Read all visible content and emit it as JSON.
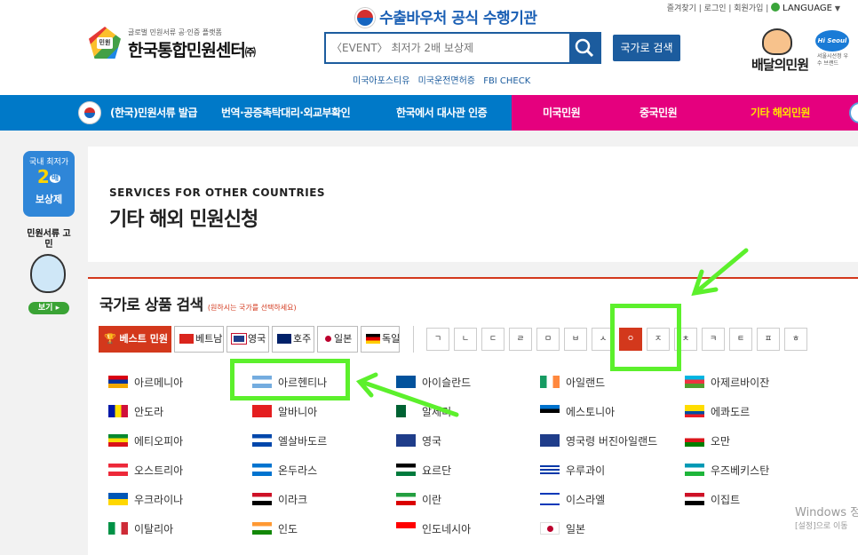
{
  "header": {
    "top_links": "즐겨찾기 | 로그인 | 회원가입 |",
    "language_label": "LANGUAGE",
    "logo_tagline": "글로벌 민원서류 공·인증 플랫폼",
    "logo_name": "한국통합민원센터",
    "logo_suffix": "㈜",
    "logo_badge": "민원",
    "voucher_title": "수출바우처 공식 수행기관",
    "search_placeholder": "〈EVENT〉 최저가 2배 보상제",
    "search_country_button": "국가로 검색",
    "quick_links": [
      "미국아포스티유",
      "미국운전면허증",
      "FBI CHECK"
    ],
    "right_brand": "배달의민원",
    "right_badge": "Hi Seoul",
    "right_badge_sub": "서울시선정 우수 브랜드"
  },
  "nav": {
    "items": [
      "(한국)민원서류 발급",
      "번역·공증촉탁대리·외교부확인",
      "한국에서 대사관 인증",
      "미국민원",
      "중국민원",
      "기타 해외민원"
    ]
  },
  "side": {
    "promo_line1": "국내 최저가",
    "promo_big": "2",
    "promo_unit": "배",
    "promo_line3": "보상제",
    "mascot_title": "민원서류 고민",
    "mascot_button": "보기"
  },
  "main": {
    "title_en": "SERVICES FOR OTHER COUNTRIES",
    "title_ko": "기타 해외 민원신청",
    "search_heading": "국가로 상품 검색",
    "search_hint": "(원하시는 국가를 선택하세요)",
    "quick_chips": [
      "베스트 민원",
      "베트남",
      "영국",
      "호주",
      "일본",
      "독일"
    ],
    "consonants": [
      "ㄱ",
      "ㄴ",
      "ㄷ",
      "ㄹ",
      "ㅁ",
      "ㅂ",
      "ㅅ",
      "ㅇ",
      "ㅈ",
      "ㅊ",
      "ㅋ",
      "ㅌ",
      "ㅍ",
      "ㅎ"
    ],
    "selected_consonant": "ㅇ",
    "countries": [
      "아르메니아",
      "아르헨티나",
      "아이슬란드",
      "아일랜드",
      "아제르바이잔",
      "안도라",
      "알바니아",
      "알제리",
      "에스토니아",
      "에콰도르",
      "에티오피아",
      "엘살바도르",
      "영국",
      "영국령 버진아일랜드",
      "오만",
      "오스트리아",
      "온두라스",
      "요르단",
      "우루과이",
      "우즈베키스탄",
      "우크라이나",
      "이라크",
      "이란",
      "이스라엘",
      "이집트",
      "이탈리아",
      "인도",
      "인도네시아",
      "일본"
    ]
  },
  "windows_watermark": {
    "line1": "Windows 정",
    "line2": "[설정]으로 이동"
  },
  "colors": {
    "nav_blue": "#0079c8",
    "nav_active": "#e5007e",
    "accent_red": "#d3381c",
    "search_blue": "#1c5c9e",
    "highlight_green": "#5cf02c"
  }
}
